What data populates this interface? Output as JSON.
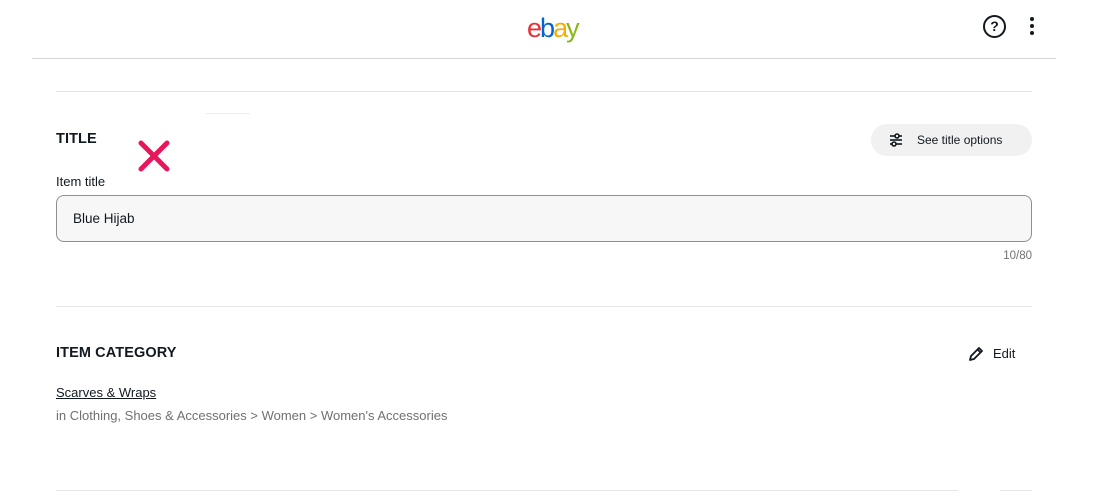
{
  "header": {
    "logo": {
      "letters": [
        {
          "char": "e",
          "color": "#e53238"
        },
        {
          "char": "b",
          "color": "#0064d2"
        },
        {
          "char": "a",
          "color": "#f5af02"
        },
        {
          "char": "y",
          "color": "#86b817"
        }
      ]
    },
    "help_glyph": "?",
    "help_icon": "help-circle-icon",
    "more_icon": "vertical-dots-icon"
  },
  "title_section": {
    "heading": "TITLE",
    "options_button_label": "See title options",
    "options_icon": "sliders-icon",
    "marker_icon": "x-icon",
    "marker_color": "#e8175d",
    "field_label": "Item title",
    "field_value": "Blue Hijab",
    "char_count": "10/80"
  },
  "category_section": {
    "heading": "ITEM CATEGORY",
    "edit_label": "Edit",
    "edit_icon": "pencil-icon",
    "category_name": "Scarves & Wraps",
    "category_path": "in Clothing, Shoes & Accessories > Women > Women's Accessories"
  }
}
